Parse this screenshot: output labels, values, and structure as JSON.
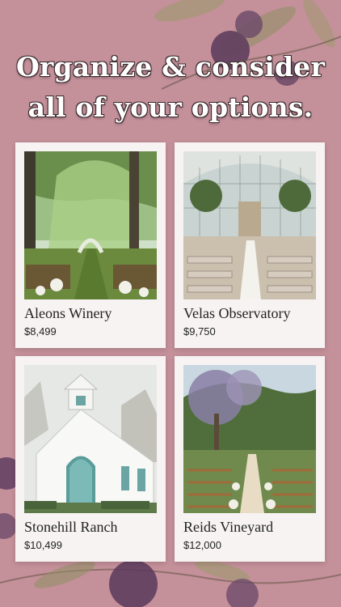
{
  "headline": {
    "line1": "Organize & consider",
    "line2": "all of your options."
  },
  "venues": [
    {
      "name": "Aleons Winery",
      "price": "$8,499"
    },
    {
      "name": "Velas Observatory",
      "price": "$9,750"
    },
    {
      "name": "Stonehill Ranch",
      "price": "$10,499"
    },
    {
      "name": "Reids Vineyard",
      "price": "$12,000"
    }
  ],
  "colors": {
    "background": "#c4909a",
    "card": "#f7f3f3",
    "plum": "#5a3a5c",
    "leaf": "#8a8a5a"
  }
}
